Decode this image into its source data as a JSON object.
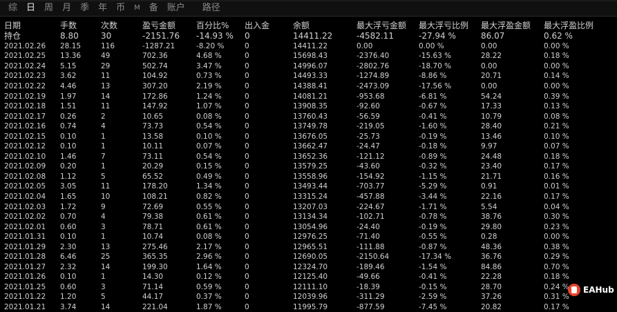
{
  "tabs": [
    {
      "label": "综",
      "active": false
    },
    {
      "label": "日",
      "active": true
    },
    {
      "label": "周",
      "active": false
    },
    {
      "label": "月",
      "active": false
    },
    {
      "label": "季",
      "active": false
    },
    {
      "label": "年",
      "active": false
    },
    {
      "label": "币",
      "active": false
    },
    {
      "label": "M",
      "active": false
    },
    {
      "label": "备",
      "active": false
    },
    {
      "label": "账户",
      "active": false
    },
    {
      "label": "路径",
      "active": false
    }
  ],
  "colors": {
    "positive": "#2be35e",
    "negative": "#ff2828",
    "neutral": "#e2e2e2"
  },
  "columns": [
    "日期",
    "手数",
    "次数",
    "盈亏金额",
    "百分比%",
    "出入金",
    "余额",
    "最大浮亏金额",
    "最大浮亏比例",
    "最大浮盈金额",
    "最大浮盈比例"
  ],
  "rows": [
    {
      "cells": [
        "持仓",
        "8.80",
        "30",
        "-2151.76",
        "-14.93 %",
        "0",
        "14411.22",
        "-4582.11",
        "-27.94 %",
        "86.07",
        "0.62 %"
      ],
      "pl": "g",
      "flp": "r",
      "hold": true
    },
    {
      "cells": [
        "2021.02.26",
        "28.15",
        "116",
        "-1287.21",
        "-8.20 %",
        "0",
        "14411.22",
        "0.00",
        "0.00 %",
        "0.00",
        "0.00 %"
      ],
      "pl": "g",
      "flp": "w"
    },
    {
      "cells": [
        "2021.02.25",
        "13.36",
        "49",
        "702.36",
        "4.68 %",
        "0",
        "15698.43",
        "-2376.40",
        "-15.63 %",
        "28.22",
        "0.18 %"
      ],
      "pl": "r",
      "flp": "r"
    },
    {
      "cells": [
        "2021.02.24",
        "5.15",
        "29",
        "502.74",
        "3.47 %",
        "0",
        "14996.07",
        "-2802.76",
        "-18.70 %",
        "0.00",
        "0.00 %"
      ],
      "pl": "r",
      "flp": "w"
    },
    {
      "cells": [
        "2021.02.23",
        "3.62",
        "11",
        "104.92",
        "0.73 %",
        "0",
        "14493.33",
        "-1274.89",
        "-8.86 %",
        "20.71",
        "0.14 %"
      ],
      "pl": "r",
      "flp": "r"
    },
    {
      "cells": [
        "2021.02.22",
        "4.46",
        "13",
        "307.20",
        "2.19 %",
        "0",
        "14388.41",
        "-2473.09",
        "-17.56 %",
        "0.00",
        "0.00 %"
      ],
      "pl": "r",
      "flp": "w"
    },
    {
      "cells": [
        "2021.02.19",
        "1.97",
        "14",
        "172.86",
        "1.24 %",
        "0",
        "14081.21",
        "-953.68",
        "-6.81 %",
        "54.24",
        "0.39 %"
      ],
      "pl": "r",
      "flp": "r"
    },
    {
      "cells": [
        "2021.02.18",
        "1.51",
        "11",
        "147.92",
        "1.07 %",
        "0",
        "13908.35",
        "-92.60",
        "-0.67 %",
        "17.33",
        "0.13 %"
      ],
      "pl": "r",
      "flp": "r"
    },
    {
      "cells": [
        "2021.02.17",
        "0.26",
        "2",
        "10.65",
        "0.08 %",
        "0",
        "13760.43",
        "-56.59",
        "-0.41 %",
        "10.79",
        "0.08 %"
      ],
      "pl": "r",
      "flp": "r"
    },
    {
      "cells": [
        "2021.02.16",
        "0.74",
        "4",
        "73.73",
        "0.54 %",
        "0",
        "13749.78",
        "-219.05",
        "-1.60 %",
        "28.40",
        "0.21 %"
      ],
      "pl": "r",
      "flp": "r"
    },
    {
      "cells": [
        "2021.02.15",
        "0.10",
        "1",
        "13.58",
        "0.10 %",
        "0",
        "13676.05",
        "-25.73",
        "-0.19 %",
        "13.46",
        "0.10 %"
      ],
      "pl": "r",
      "flp": "r"
    },
    {
      "cells": [
        "2021.02.12",
        "0.10",
        "1",
        "10.11",
        "0.07 %",
        "0",
        "13662.47",
        "-24.47",
        "-0.18 %",
        "9.97",
        "0.07 %"
      ],
      "pl": "r",
      "flp": "r"
    },
    {
      "cells": [
        "2021.02.10",
        "1.46",
        "7",
        "73.11",
        "0.54 %",
        "0",
        "13652.36",
        "-121.12",
        "-0.89 %",
        "24.48",
        "0.18 %"
      ],
      "pl": "r",
      "flp": "r"
    },
    {
      "cells": [
        "2021.02.09",
        "0.20",
        "1",
        "20.29",
        "0.15 %",
        "0",
        "13579.25",
        "-43.60",
        "-0.32 %",
        "23.40",
        "0.17 %"
      ],
      "pl": "r",
      "flp": "r"
    },
    {
      "cells": [
        "2021.02.08",
        "1.12",
        "5",
        "65.52",
        "0.49 %",
        "0",
        "13558.96",
        "-154.92",
        "-1.15 %",
        "21.71",
        "0.16 %"
      ],
      "pl": "r",
      "flp": "r"
    },
    {
      "cells": [
        "2021.02.05",
        "3.05",
        "11",
        "178.20",
        "1.34 %",
        "0",
        "13493.44",
        "-703.77",
        "-5.29 %",
        "0.91",
        "0.01 %"
      ],
      "pl": "r",
      "flp": "r"
    },
    {
      "cells": [
        "2021.02.04",
        "1.65",
        "10",
        "108.21",
        "0.82 %",
        "0",
        "13315.24",
        "-457.88",
        "-3.44 %",
        "22.16",
        "0.17 %"
      ],
      "pl": "r",
      "flp": "r"
    },
    {
      "cells": [
        "2021.02.03",
        "1.72",
        "9",
        "72.69",
        "0.55 %",
        "0",
        "13207.03",
        "-224.67",
        "-1.71 %",
        "5.54",
        "0.04 %"
      ],
      "pl": "r",
      "flp": "r"
    },
    {
      "cells": [
        "2021.02.02",
        "0.70",
        "4",
        "79.38",
        "0.61 %",
        "0",
        "13134.34",
        "-102.71",
        "-0.78 %",
        "38.76",
        "0.30 %"
      ],
      "pl": "r",
      "flp": "r"
    },
    {
      "cells": [
        "2021.02.01",
        "0.60",
        "3",
        "78.71",
        "0.61 %",
        "0",
        "13054.96",
        "-24.40",
        "-0.19 %",
        "29.80",
        "0.23 %"
      ],
      "pl": "r",
      "flp": "r"
    },
    {
      "cells": [
        "2021.01.31",
        "0.10",
        "1",
        "10.74",
        "0.08 %",
        "0",
        "12976.25",
        "-71.40",
        "-0.55 %",
        "0.28",
        "0.00 %"
      ],
      "pl": "r",
      "flp": "r"
    },
    {
      "cells": [
        "2021.01.29",
        "2.30",
        "13",
        "275.46",
        "2.17 %",
        "0",
        "12965.51",
        "-111.88",
        "-0.87 %",
        "48.36",
        "0.38 %"
      ],
      "pl": "r",
      "flp": "r"
    },
    {
      "cells": [
        "2021.01.28",
        "6.46",
        "25",
        "365.35",
        "2.96 %",
        "0",
        "12690.05",
        "-2150.64",
        "-17.34 %",
        "36.76",
        "0.29 %"
      ],
      "pl": "r",
      "flp": "r"
    },
    {
      "cells": [
        "2021.01.27",
        "2.32",
        "14",
        "199.30",
        "1.64 %",
        "0",
        "12324.70",
        "-189.46",
        "-1.54 %",
        "84.86",
        "0.70 %"
      ],
      "pl": "r",
      "flp": "r"
    },
    {
      "cells": [
        "2021.01.26",
        "0.10",
        "1",
        "14.30",
        "0.12 %",
        "0",
        "12125.40",
        "-49.66",
        "-0.41 %",
        "22.28",
        "0.18 %"
      ],
      "pl": "r",
      "flp": "r"
    },
    {
      "cells": [
        "2021.01.25",
        "0.60",
        "3",
        "71.14",
        "0.59 %",
        "0",
        "12111.10",
        "-18.39",
        "-0.15 %",
        "28.70",
        "0.24 %"
      ],
      "pl": "r",
      "flp": "r"
    },
    {
      "cells": [
        "2021.01.22",
        "1.20",
        "5",
        "44.17",
        "0.37 %",
        "0",
        "12039.96",
        "-311.29",
        "-2.59 %",
        "37.26",
        "0.31 %"
      ],
      "pl": "r",
      "flp": "r"
    },
    {
      "cells": [
        "2021.01.21",
        "3.74",
        "14",
        "221.04",
        "1.87 %",
        "0",
        "11995.79",
        "-877.59",
        "-7.45 %",
        "20.82",
        "0.17 %"
      ],
      "pl": "r",
      "flp": "r"
    }
  ],
  "logo": {
    "text": "EAHub"
  }
}
